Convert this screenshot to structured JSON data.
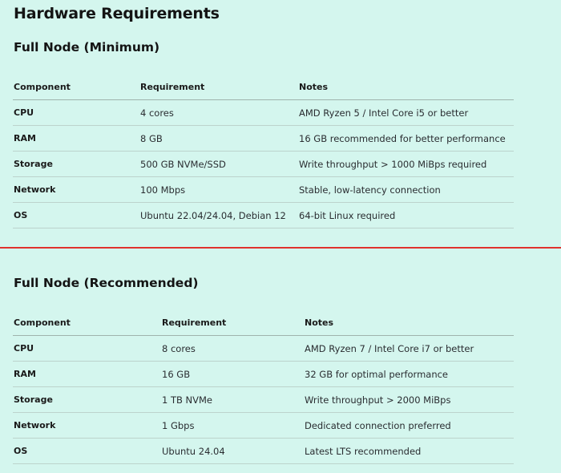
{
  "page": {
    "title": "Hardware Requirements"
  },
  "sections": [
    {
      "title": "Full Node (Minimum)",
      "headers": [
        "Component",
        "Requirement",
        "Notes"
      ],
      "rows": [
        {
          "component": "CPU",
          "requirement": "4 cores",
          "notes": "AMD Ryzen 5 / Intel Core i5 or better"
        },
        {
          "component": "RAM",
          "requirement": "8 GB",
          "notes": "16 GB recommended for better performance"
        },
        {
          "component": "Storage",
          "requirement": "500 GB NVMe/SSD",
          "notes": "Write throughput > 1000 MiBps required"
        },
        {
          "component": "Network",
          "requirement": "100 Mbps",
          "notes": "Stable, low-latency connection"
        },
        {
          "component": "OS",
          "requirement": "Ubuntu 22.04/24.04, Debian 12",
          "notes": "64-bit Linux required"
        }
      ]
    },
    {
      "title": "Full Node (Recommended)",
      "headers": [
        "Component",
        "Requirement",
        "Notes"
      ],
      "rows": [
        {
          "component": "CPU",
          "requirement": "8 cores",
          "notes": "AMD Ryzen 7 / Intel Core i7 or better"
        },
        {
          "component": "RAM",
          "requirement": "16 GB",
          "notes": "32 GB for optimal performance"
        },
        {
          "component": "Storage",
          "requirement": "1 TB NVMe",
          "notes": "Write throughput > 2000 MiBps"
        },
        {
          "component": "Network",
          "requirement": "1 Gbps",
          "notes": "Dedicated connection preferred"
        },
        {
          "component": "OS",
          "requirement": "Ubuntu 24.04",
          "notes": "Latest LTS recommended"
        }
      ]
    }
  ],
  "colors": {
    "background": "#d4f6ee",
    "divider": "#e0322d"
  }
}
